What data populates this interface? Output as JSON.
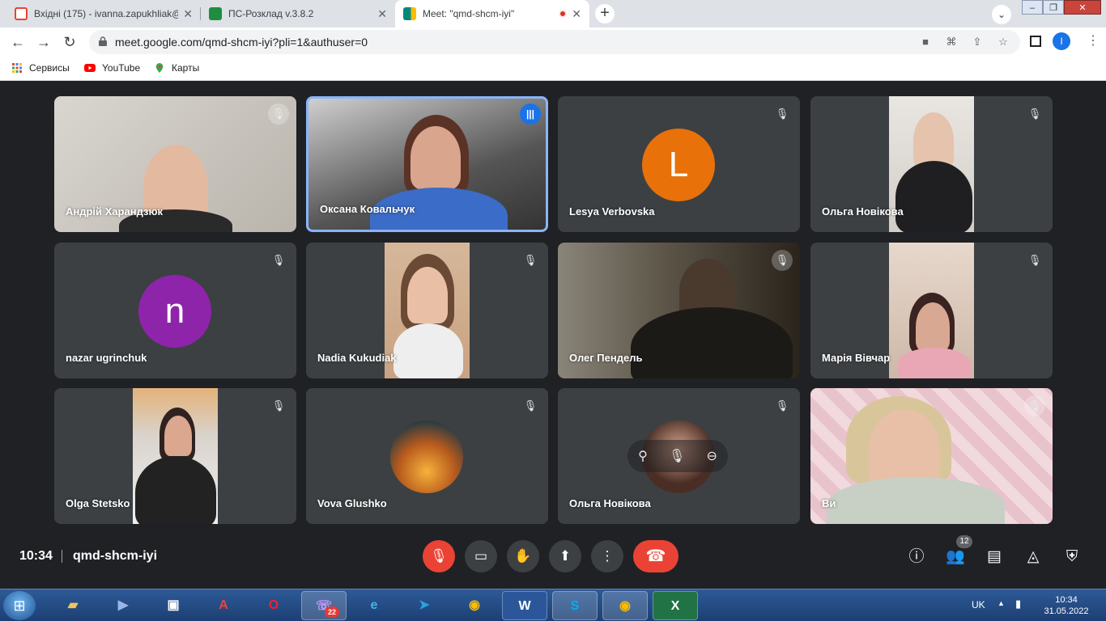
{
  "browser": {
    "tabs": [
      {
        "title": "Вхідні (175) - ivanna.zapukhliak@",
        "icon": "gmail-icon",
        "color": "#ea4335"
      },
      {
        "title": "ПС-Розклад v.3.8.2",
        "icon": "schedule-icon",
        "color": "#1e8e3e"
      },
      {
        "title": "Meet: \"qmd-shcm-iyi\"",
        "icon": "meet-icon",
        "color": "#00897b"
      }
    ],
    "new_tab": "+",
    "tab_menu": "⌄",
    "url": "meet.google.com/qmd-shcm-iyi?pli=1&authuser=0",
    "profile_initial": "I",
    "bookmarks": [
      "Сервисы",
      "YouTube",
      "Карты"
    ]
  },
  "tiles": [
    {
      "name": "Андрій Харандзюк",
      "muted": true
    },
    {
      "name": "Оксана Ковальчук",
      "muted": false,
      "speaking": true
    },
    {
      "name": "Lesya Verbovska",
      "muted": true,
      "avatar": "L",
      "avatar_color": "#e8710a"
    },
    {
      "name": "Ольга Новікова",
      "muted": true
    },
    {
      "name": "nazar ugrinchuk",
      "muted": true,
      "avatar": "n",
      "avatar_color": "#8e24aa"
    },
    {
      "name": "Nadia Kukudiak",
      "muted": true
    },
    {
      "name": "Олег Пендель",
      "muted": true
    },
    {
      "name": "Марія Вівчар",
      "muted": true
    },
    {
      "name": "Olga Stetsko",
      "muted": true
    },
    {
      "name": "Vova Glushko",
      "muted": true
    },
    {
      "name": "Ольга Новікова",
      "muted": true
    },
    {
      "name": "Ви",
      "muted": true
    }
  ],
  "bottom": {
    "time": "10:34",
    "meeting_code": "qmd-shcm-iyi",
    "participants_count": "12"
  },
  "taskbar": {
    "viber_badge": "22",
    "language": "UK",
    "time": "10:34",
    "date": "31.05.2022"
  }
}
